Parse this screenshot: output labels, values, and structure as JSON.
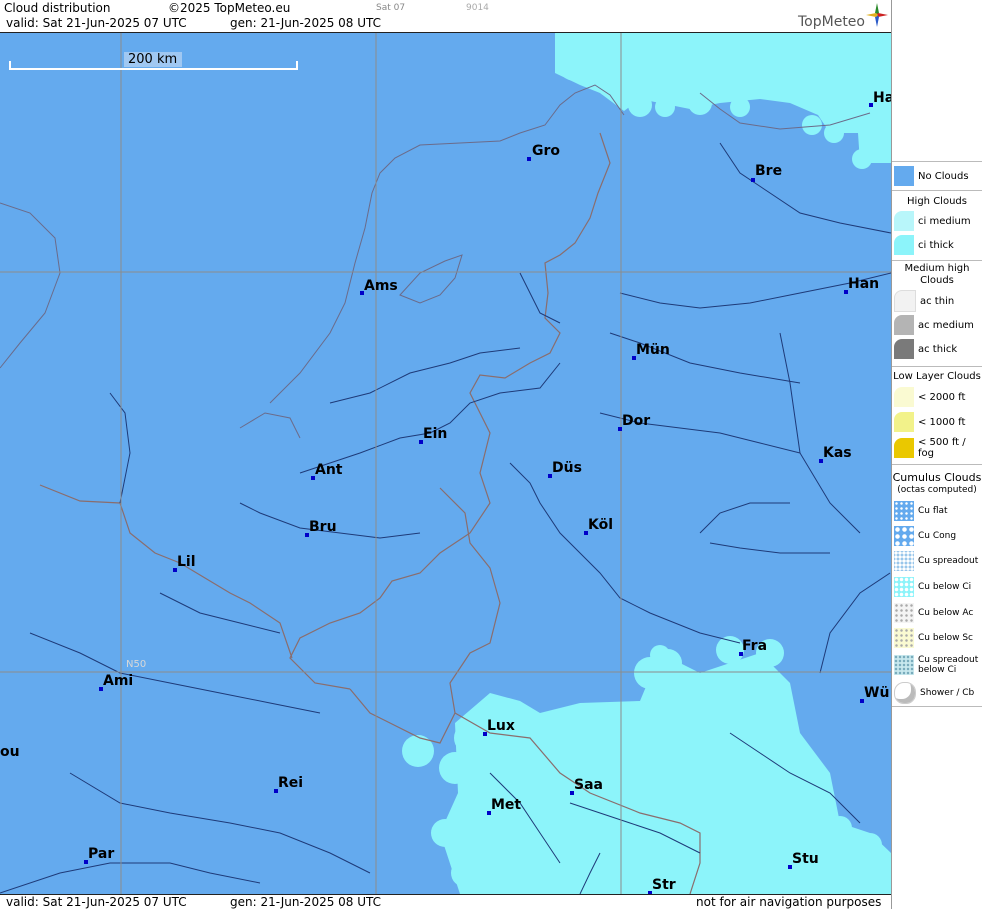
{
  "header": {
    "title": "Cloud distribution",
    "copyright": "©2025 TopMeteo.eu",
    "sat_code": "Sat 07",
    "number": "9014",
    "valid": "valid:  Sat  21-Jun-2025  07 UTC",
    "gen": "gen: 21-Jun-2025 08 UTC",
    "brand": "TopMeteo"
  },
  "footer": {
    "valid": "valid:  Sat  21-Jun-2025  07 UTC",
    "gen": "gen: 21-Jun-2025 08 UTC",
    "disclaimer": "not for air navigation purposes"
  },
  "map": {
    "scale_label": "200 km",
    "lat_label": "N50",
    "colors": {
      "no_clouds": "#64aaee",
      "ci_thick": "#8cf4fa",
      "border": "#8a6d6d",
      "river": "#1e3a78",
      "grid": "#888888"
    },
    "cities": [
      "Gro",
      "Bre",
      "Ha",
      "Ams",
      "Han",
      "Mün",
      "Ein",
      "Dor",
      "Ant",
      "Düs",
      "Kas",
      "Bru",
      "Köl",
      "Lil",
      "Fra",
      "Ami",
      "Wü",
      "Lux",
      "ou",
      "Rei",
      "Saa",
      "Met",
      "Par",
      "Stu",
      "Str"
    ]
  },
  "legend": {
    "no_clouds": "No Clouds",
    "high_title": "High Clouds",
    "ci_medium": "ci medium",
    "ci_thick": "ci thick",
    "medium_title": "Medium high Clouds",
    "ac_thin": "ac thin",
    "ac_medium": "ac medium",
    "ac_thick": "ac thick",
    "low_title": "Low Layer Clouds",
    "low_2000": "< 2000 ft",
    "low_1000": "< 1000 ft",
    "low_500": "< 500 ft / fog",
    "cu_title": "Cumulus Clouds",
    "cu_sub": "(octas computed)",
    "cu_flat": "Cu flat",
    "cu_cong": "Cu Cong",
    "cu_spreadout": "Cu spreadout",
    "cu_below_ci": "Cu below Ci",
    "cu_below_ac": "Cu below Ac",
    "cu_below_sc": "Cu below Sc",
    "cu_spreadout_below_ci": "Cu spreadout below Ci",
    "shower": "Shower / Cb"
  }
}
